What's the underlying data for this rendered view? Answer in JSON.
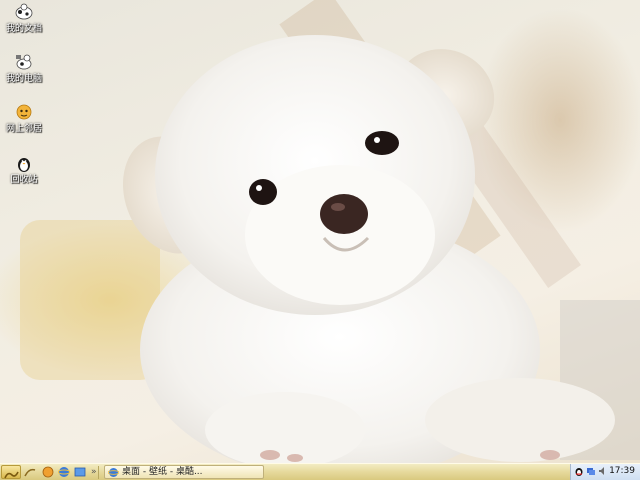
{
  "desktop": {
    "icons": [
      {
        "label": "我的文档",
        "icon": "my-documents-cow-icon"
      },
      {
        "label": "我的电脑",
        "icon": "my-computer-cow-icon"
      },
      {
        "label": "网上邻居",
        "icon": "network-places-icon"
      },
      {
        "label": "回收站",
        "icon": "recycle-bin-penguin-icon"
      }
    ],
    "wallpaper": "white-puppy-photo"
  },
  "taskbar": {
    "quick_launch": [
      "start-icon",
      "show-desktop-icon",
      "ie-icon",
      "media-icon",
      "explorer-icon"
    ],
    "task_button_label": "桌面 - 壁纸 - 桌酷...",
    "tray_icons": [
      "qq-penguin-icon",
      "network-icon",
      "volume-icon",
      "security-icon"
    ],
    "clock": "17:39"
  },
  "colors": {
    "taskbar": "#e6d99c",
    "tray": "#cfdff2"
  }
}
